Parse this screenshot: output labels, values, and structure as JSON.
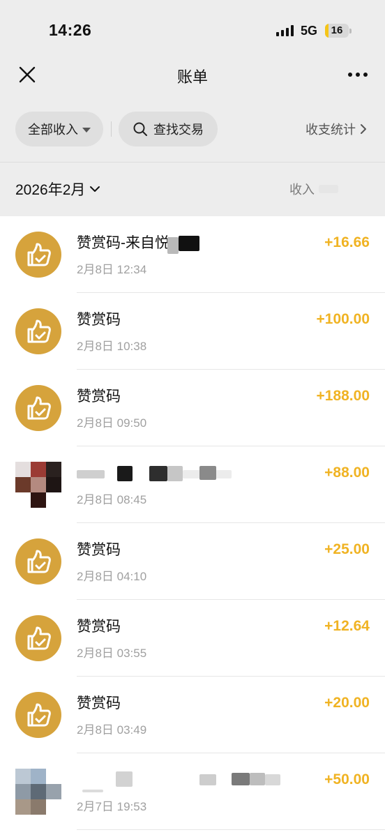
{
  "status_bar": {
    "time": "14:26",
    "network": "5G",
    "battery": "16",
    "battery_level": 0.16
  },
  "nav": {
    "title": "账单",
    "close_icon": "close-icon",
    "more_icon": "more-icon"
  },
  "filters": {
    "type_filter": "全部收入",
    "search_label": "查找交易",
    "stats_label": "收支统计"
  },
  "summary": {
    "month": "2026年2月",
    "income_label": "收入"
  },
  "colors": {
    "amount": "#f0b323",
    "reward_avatar": "#d6a33c",
    "header_bg": "#ededed"
  },
  "transactions": [
    {
      "title": "赞赏码-来自悦",
      "time": "2月8日 12:34",
      "amount": "+16.66",
      "avatar": "reward-icon"
    },
    {
      "title": "赞赏码",
      "time": "2月8日 10:38",
      "amount": "+100.00",
      "avatar": "reward-icon"
    },
    {
      "title": "赞赏码",
      "time": "2月8日 09:50",
      "amount": "+188.00",
      "avatar": "reward-icon"
    },
    {
      "title": "",
      "time": "2月8日 08:45",
      "amount": "+88.00",
      "avatar": "user-avatar"
    },
    {
      "title": "赞赏码",
      "time": "2月8日 04:10",
      "amount": "+25.00",
      "avatar": "reward-icon"
    },
    {
      "title": "赞赏码",
      "time": "2月8日 03:55",
      "amount": "+12.64",
      "avatar": "reward-icon"
    },
    {
      "title": "赞赏码",
      "time": "2月8日 03:49",
      "amount": "+20.00",
      "avatar": "reward-icon"
    },
    {
      "title": "",
      "time": "2月7日 19:53",
      "amount": "+50.00",
      "avatar": "user-avatar"
    }
  ]
}
